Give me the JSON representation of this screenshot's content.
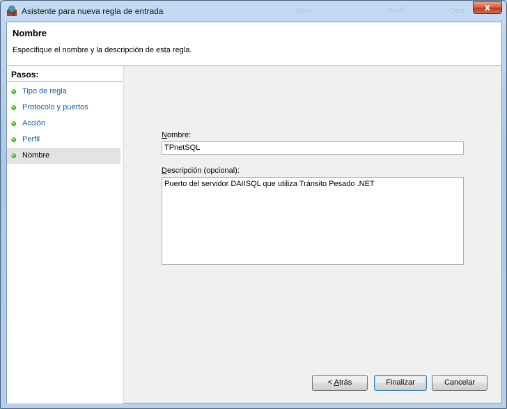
{
  "window": {
    "title": "Asistente para nueva regla de entrada",
    "close_label": "x"
  },
  "background_ghost": {
    "col1": "Domi...",
    "col2": "Perfil",
    "col3": "Otra"
  },
  "header": {
    "title": "Nombre",
    "subtitle": "Especifique el nombre y la descripción de esta regla."
  },
  "steps": {
    "title": "Pasos:",
    "items": [
      {
        "label": "Tipo de regla",
        "active": false
      },
      {
        "label": "Protocolo y puertos",
        "active": false
      },
      {
        "label": "Acción",
        "active": false
      },
      {
        "label": "Perfil",
        "active": false
      },
      {
        "label": "Nombre",
        "active": true
      }
    ]
  },
  "form": {
    "name_label_hotkey": "N",
    "name_label_rest": "ombre:",
    "name_value": "TPnetSQL",
    "desc_label_hotkey": "D",
    "desc_label_rest": "escripción (opcional):",
    "desc_value": "Puerto del servidor DAIISQL que utiliza Tránsito Pesado .NET"
  },
  "buttons": {
    "back_prefix": "< ",
    "back_hotkey": "A",
    "back_rest": "trás",
    "finish": "Finalizar",
    "cancel": "Cancelar"
  },
  "colors": {
    "step_link": "#0f5ea8",
    "step_dot": "#39b21a",
    "close_button": "#c03a1c"
  }
}
